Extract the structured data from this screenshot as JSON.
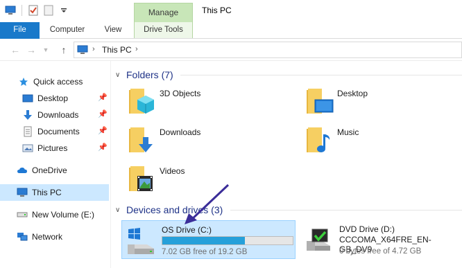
{
  "titlebar": {
    "manage_tab": "Manage",
    "title": "This PC"
  },
  "ribbon": {
    "tabs": [
      {
        "label": "File"
      },
      {
        "label": "Computer"
      },
      {
        "label": "View"
      },
      {
        "label": "Drive Tools"
      }
    ]
  },
  "address": {
    "crumb": "This PC"
  },
  "nav": {
    "items": [
      {
        "label": "Quick access",
        "icon": "star-icon"
      },
      {
        "label": "Desktop",
        "icon": "desktop-icon",
        "pinned": true
      },
      {
        "label": "Downloads",
        "icon": "download-icon",
        "pinned": true
      },
      {
        "label": "Documents",
        "icon": "documents-icon",
        "pinned": true
      },
      {
        "label": "Pictures",
        "icon": "pictures-icon",
        "pinned": true
      },
      {
        "label": "OneDrive",
        "icon": "cloud-icon"
      },
      {
        "label": "This PC",
        "icon": "computer-icon",
        "selected": true
      },
      {
        "label": "New Volume (E:)",
        "icon": "drive-icon"
      },
      {
        "label": "Network",
        "icon": "network-icon"
      }
    ]
  },
  "folders": {
    "header": "Folders (7)",
    "items": [
      {
        "label": "3D Objects",
        "icon": "3d-objects-folder-icon"
      },
      {
        "label": "Desktop",
        "icon": "desktop-folder-icon"
      },
      {
        "label": "Downloads",
        "icon": "downloads-folder-icon"
      },
      {
        "label": "Music",
        "icon": "music-folder-icon"
      },
      {
        "label": "Videos",
        "icon": "videos-folder-icon"
      }
    ]
  },
  "devices": {
    "header": "Devices and drives (3)",
    "drives": [
      {
        "name": "OS Drive (C:)",
        "free": "7.02 GB free of 19.2 GB",
        "used_fraction": 0.635,
        "selected": true
      },
      {
        "name": "DVD Drive (D:)",
        "label": "CCCOMA_X64FRE_EN-GB_DV9",
        "free": "0 bytes free of 4.72 GB"
      }
    ]
  },
  "colors": {
    "accent": "#1979ca",
    "selection": "#cce8ff",
    "manage_tab": "#c8e6b8",
    "group_header": "#1e3287",
    "arrow": "#3b2d99"
  }
}
